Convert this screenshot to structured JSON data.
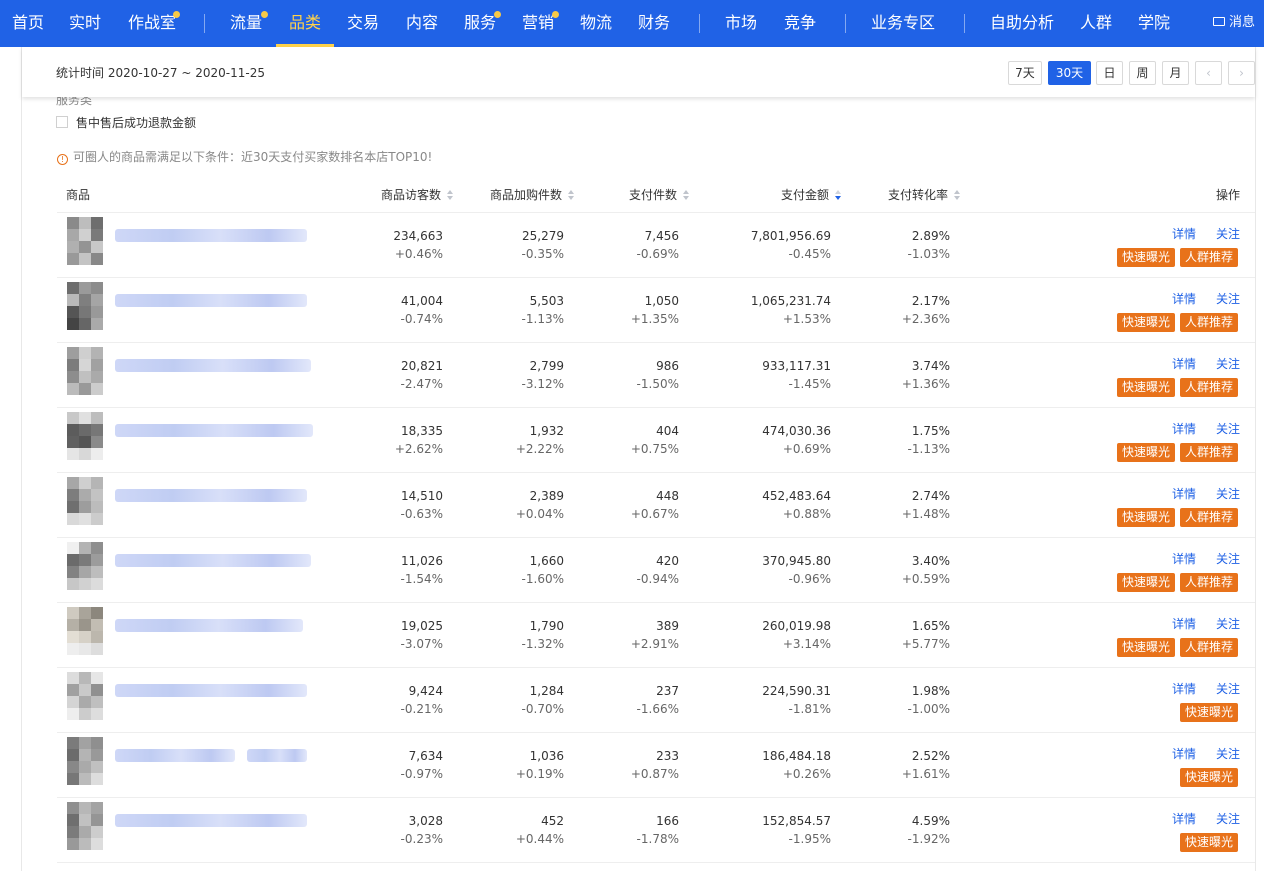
{
  "nav": {
    "items": [
      "首页",
      "实时",
      "作战室",
      "流量",
      "品类",
      "交易",
      "内容",
      "服务",
      "营销",
      "物流",
      "财务",
      "市场",
      "竞争",
      "业务专区",
      "自助分析",
      "人群",
      "学院"
    ],
    "active": "品类",
    "message": "消息"
  },
  "toolbar": {
    "stat_time": "统计时间 2020-10-27 ~ 2020-11-25",
    "periods": [
      "7天",
      "30天",
      "日",
      "周",
      "月"
    ],
    "active_period": "30天"
  },
  "filters": {
    "service_label": "服务类",
    "checkbox_label": "售中售后成功退款金额"
  },
  "notice": "可圈人的商品需满足以下条件：近30天支付买家数排名本店TOP10!",
  "table": {
    "headers": [
      "商品",
      "商品访客数",
      "商品加购件数",
      "支付件数",
      "支付金额",
      "支付转化率",
      "操作"
    ],
    "rows": [
      {
        "visitors": "234,663",
        "visitors_chg": "+0.46%",
        "cart": "25,279",
        "cart_chg": "-0.35%",
        "qty": "7,456",
        "qty_chg": "-0.69%",
        "amount": "7,801,956.69",
        "amount_chg": "-0.45%",
        "conv": "2.89%",
        "conv_chg": "-1.03%"
      },
      {
        "visitors": "41,004",
        "visitors_chg": "-0.74%",
        "cart": "5,503",
        "cart_chg": "-1.13%",
        "qty": "1,050",
        "qty_chg": "+1.35%",
        "amount": "1,065,231.74",
        "amount_chg": "+1.53%",
        "conv": "2.17%",
        "conv_chg": "+2.36%"
      },
      {
        "visitors": "20,821",
        "visitors_chg": "-2.47%",
        "cart": "2,799",
        "cart_chg": "-3.12%",
        "qty": "986",
        "qty_chg": "-1.50%",
        "amount": "933,117.31",
        "amount_chg": "-1.45%",
        "conv": "3.74%",
        "conv_chg": "+1.36%"
      },
      {
        "visitors": "18,335",
        "visitors_chg": "+2.62%",
        "cart": "1,932",
        "cart_chg": "+2.22%",
        "qty": "404",
        "qty_chg": "+0.75%",
        "amount": "474,030.36",
        "amount_chg": "+0.69%",
        "conv": "1.75%",
        "conv_chg": "-1.13%"
      },
      {
        "visitors": "14,510",
        "visitors_chg": "-0.63%",
        "cart": "2,389",
        "cart_chg": "+0.04%",
        "qty": "448",
        "qty_chg": "+0.67%",
        "amount": "452,483.64",
        "amount_chg": "+0.88%",
        "conv": "2.74%",
        "conv_chg": "+1.48%"
      },
      {
        "visitors": "11,026",
        "visitors_chg": "-1.54%",
        "cart": "1,660",
        "cart_chg": "-1.60%",
        "qty": "420",
        "qty_chg": "-0.94%",
        "amount": "370,945.80",
        "amount_chg": "-0.96%",
        "conv": "3.40%",
        "conv_chg": "+0.59%"
      },
      {
        "visitors": "19,025",
        "visitors_chg": "-3.07%",
        "cart": "1,790",
        "cart_chg": "-1.32%",
        "qty": "389",
        "qty_chg": "+2.91%",
        "amount": "260,019.98",
        "amount_chg": "+3.14%",
        "conv": "1.65%",
        "conv_chg": "+5.77%"
      },
      {
        "visitors": "9,424",
        "visitors_chg": "-0.21%",
        "cart": "1,284",
        "cart_chg": "-0.70%",
        "qty": "237",
        "qty_chg": "-1.66%",
        "amount": "224,590.31",
        "amount_chg": "-1.81%",
        "conv": "1.98%",
        "conv_chg": "-1.00%"
      },
      {
        "visitors": "7,634",
        "visitors_chg": "-0.97%",
        "cart": "1,036",
        "cart_chg": "+0.19%",
        "qty": "233",
        "qty_chg": "+0.87%",
        "amount": "186,484.18",
        "amount_chg": "+0.26%",
        "conv": "2.52%",
        "conv_chg": "+1.61%"
      },
      {
        "visitors": "3,028",
        "visitors_chg": "-0.23%",
        "cart": "452",
        "cart_chg": "+0.44%",
        "qty": "166",
        "qty_chg": "-1.78%",
        "amount": "152,854.57",
        "amount_chg": "-1.95%",
        "conv": "4.59%",
        "conv_chg": "-1.92%"
      }
    ],
    "actions": {
      "detail": "详情",
      "follow": "关注",
      "quick_exposure": "快速曝光",
      "crowd_recommend": "人群推荐"
    }
  },
  "colors": {
    "nav_bg": "#2062e6",
    "accent": "#2062e6",
    "active_nav": "#ffd24a",
    "action_orange": "#e8721a"
  }
}
